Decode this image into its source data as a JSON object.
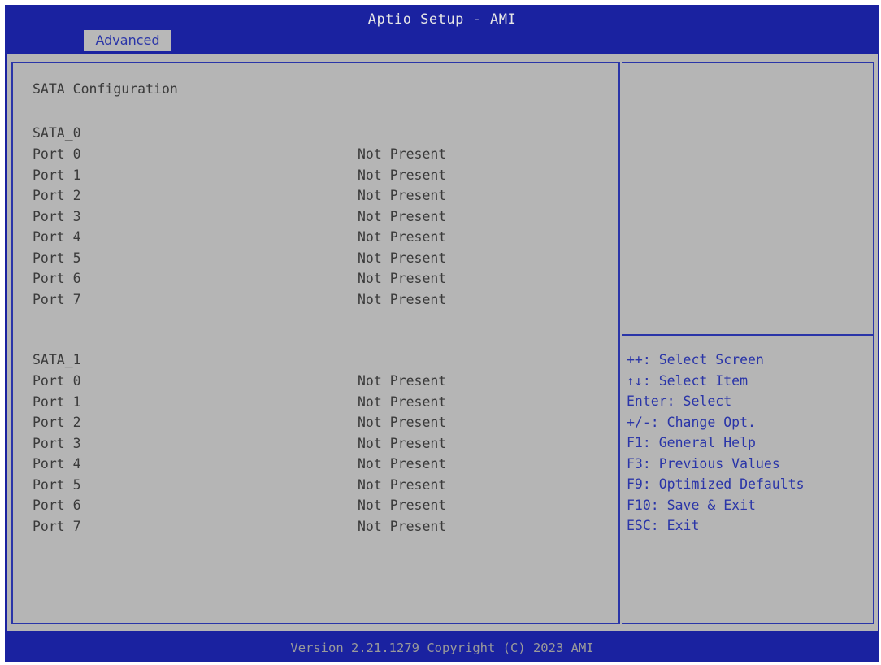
{
  "app": {
    "title": "Aptio Setup - AMI",
    "active_tab": "Advanced",
    "footer": "Version 2.21.1279 Copyright (C) 2023 AMI"
  },
  "colors": {
    "background": "#1a22a0",
    "panel": "#b5b5b5",
    "accent": "#2a35a8",
    "text": "#3a3a3a"
  },
  "page": {
    "heading": "SATA Configuration",
    "groups": [
      {
        "name": "SATA_0",
        "ports": [
          {
            "label": "Port 0",
            "status": "Not Present"
          },
          {
            "label": "Port 1",
            "status": "Not Present"
          },
          {
            "label": "Port 2",
            "status": "Not Present"
          },
          {
            "label": "Port 3",
            "status": "Not Present"
          },
          {
            "label": "Port 4",
            "status": "Not Present"
          },
          {
            "label": "Port 5",
            "status": "Not Present"
          },
          {
            "label": "Port 6",
            "status": "Not Present"
          },
          {
            "label": "Port 7",
            "status": "Not Present"
          }
        ]
      },
      {
        "name": "SATA_1",
        "ports": [
          {
            "label": "Port 0",
            "status": "Not Present"
          },
          {
            "label": "Port 1",
            "status": "Not Present"
          },
          {
            "label": "Port 2",
            "status": "Not Present"
          },
          {
            "label": "Port 3",
            "status": "Not Present"
          },
          {
            "label": "Port 4",
            "status": "Not Present"
          },
          {
            "label": "Port 5",
            "status": "Not Present"
          },
          {
            "label": "Port 6",
            "status": "Not Present"
          },
          {
            "label": "Port 7",
            "status": "Not Present"
          }
        ]
      }
    ]
  },
  "help": [
    "++: Select Screen",
    "↑↓: Select Item",
    "Enter: Select",
    "+/-: Change Opt.",
    "F1: General Help",
    "F3: Previous Values",
    "F9: Optimized Defaults",
    "F10: Save & Exit",
    "ESC: Exit"
  ]
}
